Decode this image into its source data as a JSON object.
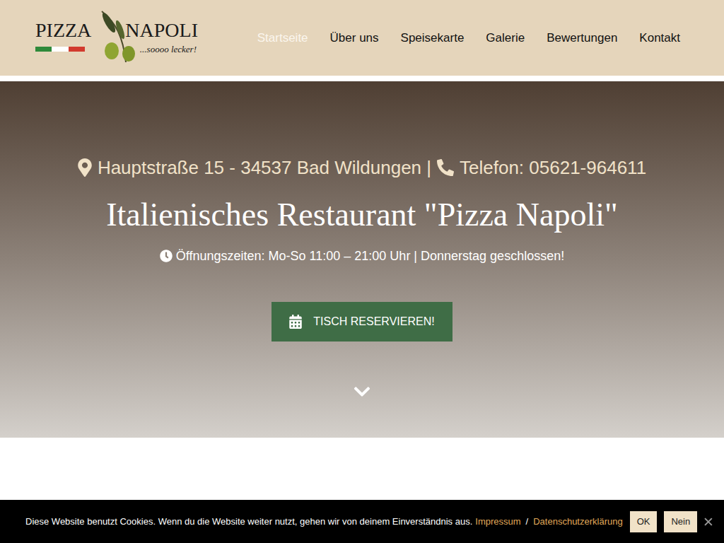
{
  "logo": {
    "title_left": "PIZZA",
    "title_right": "NAPOLI",
    "tagline": "...soooo lecker!"
  },
  "nav": [
    {
      "label": "Startseite",
      "selected": true
    },
    {
      "label": "Über uns",
      "selected": false
    },
    {
      "label": "Speisekarte",
      "selected": false
    },
    {
      "label": "Galerie",
      "selected": false
    },
    {
      "label": "Bewertungen",
      "selected": false
    },
    {
      "label": "Kontakt",
      "selected": false
    }
  ],
  "hero": {
    "address": "Hauptstraße 15 - 34537 Bad Wildungen |",
    "phone": "Telefon: 05621-964611",
    "title": "Italienisches Restaurant \"Pizza Napoli\"",
    "hours": "Öffnungszeiten: Mo-So 11:00 – 21:00 Uhr | Donnerstag geschlossen!",
    "button": "TISCH RESERVIEREN!"
  },
  "cookie_bar": {
    "text": "Diese Website benutzt Cookies. Wenn du die Website weiter nutzt, gehen wir von deinem Einverständnis aus.",
    "links": [
      "Impressum",
      "Datenschutzerklärung"
    ],
    "separator": "/",
    "buttons": [
      "OK",
      "Nein"
    ]
  }
}
